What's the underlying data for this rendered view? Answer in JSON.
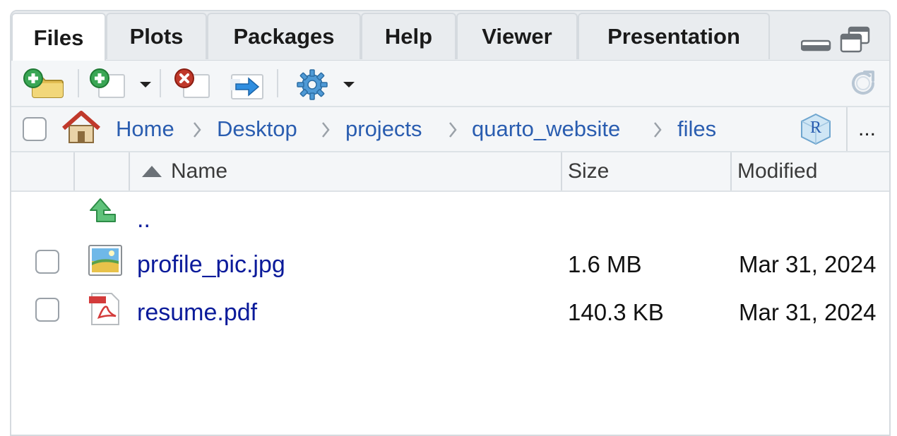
{
  "tabs": [
    "Files",
    "Plots",
    "Packages",
    "Help",
    "Viewer",
    "Presentation"
  ],
  "breadcrumb": [
    "Home",
    "Desktop",
    "projects",
    "quarto_website",
    "files"
  ],
  "more_label": "...",
  "r_badge": "R",
  "columns": {
    "name": "Name",
    "size": "Size",
    "modified": "Modified"
  },
  "parent_dir": "..",
  "files": [
    {
      "name": "profile_pic.jpg",
      "size": "1.6 MB",
      "modified": "Mar 31, 2024",
      "icon": "image-file-icon"
    },
    {
      "name": "resume.pdf",
      "size": "140.3 KB",
      "modified": "Mar 31, 2024",
      "icon": "pdf-file-icon"
    }
  ],
  "colors": {
    "link": "#2a5db0",
    "file_link": "#0a1a9a",
    "tab_bg": "#e9ecef",
    "toolbar_bg": "#f4f6f8"
  }
}
